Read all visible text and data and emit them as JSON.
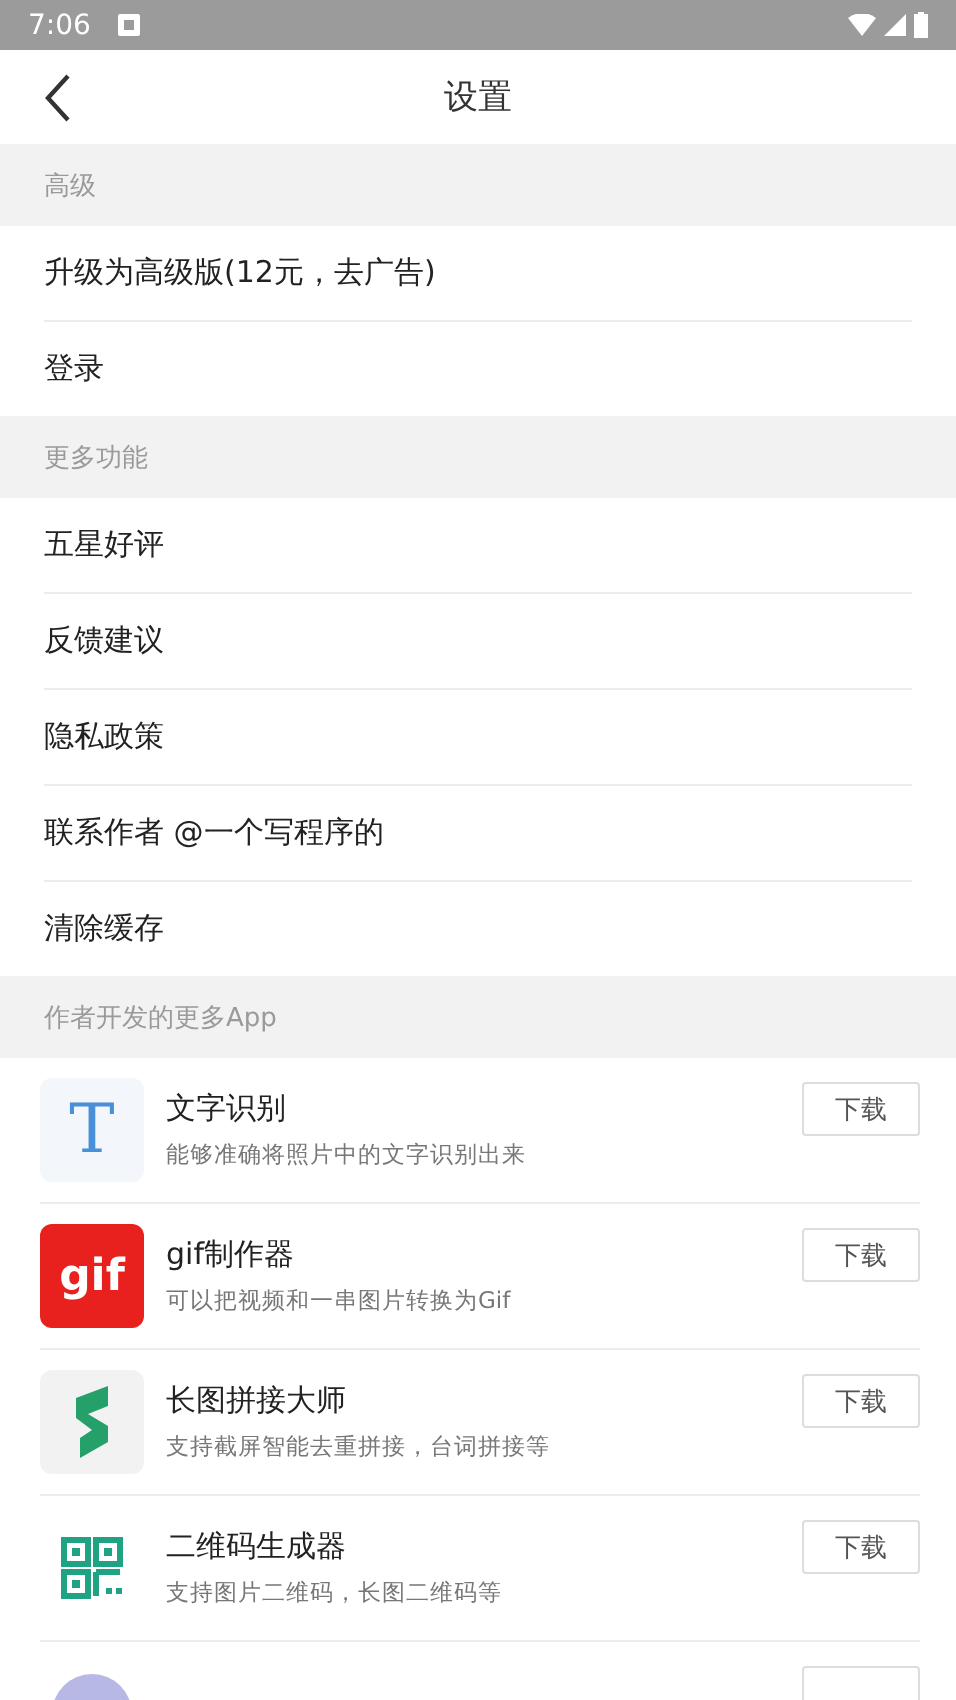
{
  "status_bar": {
    "time": "7:06"
  },
  "header": {
    "title": "设置"
  },
  "sections": [
    {
      "title": "高级",
      "items": [
        "升级为高级版(12元，去广告)",
        "登录"
      ]
    },
    {
      "title": "更多功能",
      "items": [
        "五星好评",
        "反馈建议",
        "隐私政策",
        "联系作者 @一个写程序的",
        "清除缓存"
      ]
    },
    {
      "title": "作者开发的更多App",
      "apps": [
        {
          "kind": "letter",
          "icon_text": "T",
          "name": "文字识别",
          "desc": "能够准确将照片中的文字识别出来",
          "button": "下载"
        },
        {
          "kind": "label",
          "icon_text": "gif",
          "name": "gif制作器",
          "desc": "可以把视频和一串图片转换为Gif",
          "button": "下载"
        },
        {
          "kind": "stitch",
          "name": "长图拼接大师",
          "desc": "支持截屏智能去重拼接，台词拼接等",
          "button": "下载"
        },
        {
          "kind": "qr",
          "name": "二维码生成器",
          "desc": "支持图片二维码，长图二维码等",
          "button": "下载"
        },
        {
          "kind": "circle"
        }
      ]
    }
  ]
}
